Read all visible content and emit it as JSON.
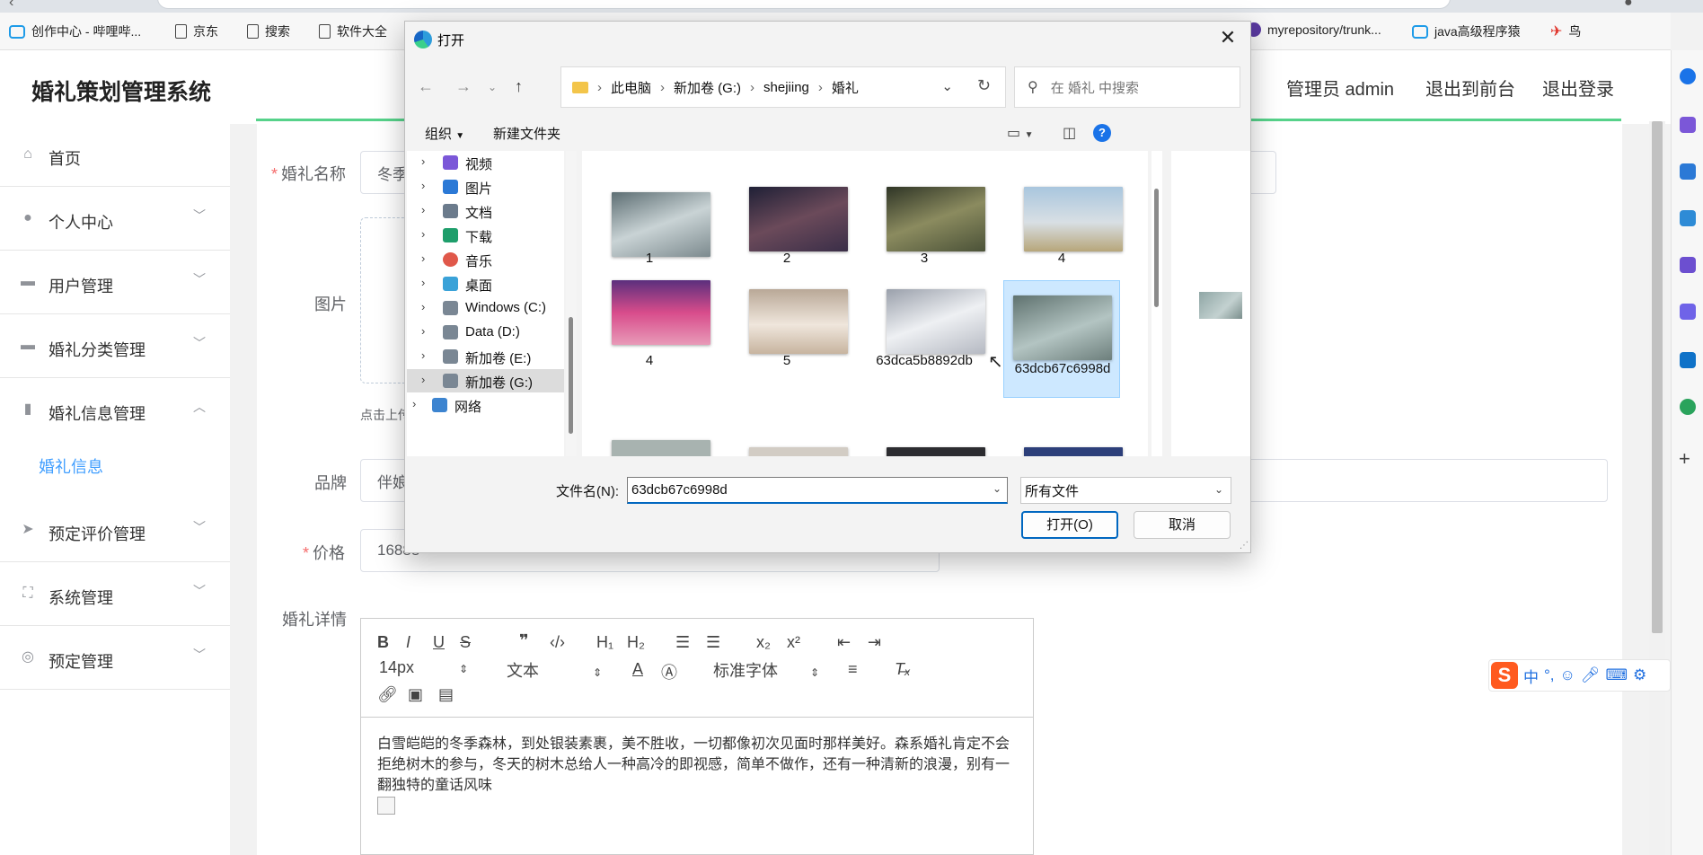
{
  "bookmarks": [
    "创作中心 - 哔哩哔...",
    "京东",
    "搜索",
    "软件大全",
    "myrepository/trunk...",
    "java高级程序猿",
    "鸟"
  ],
  "app": {
    "title": "婚礼策划管理系统",
    "admin_label": "管理员 admin",
    "to_front": "退出到前台",
    "logout": "退出登录"
  },
  "sidebar": {
    "items": [
      {
        "label": "首页",
        "icon": "home-icon"
      },
      {
        "label": "个人中心",
        "icon": "user-icon"
      },
      {
        "label": "用户管理",
        "icon": "chat-icon"
      },
      {
        "label": "婚礼分类管理",
        "icon": "folder-icon"
      },
      {
        "label": "婚礼信息管理",
        "icon": "chart-icon"
      },
      {
        "label": "预定评价管理",
        "icon": "send-icon"
      },
      {
        "label": "系统管理",
        "icon": "frame-icon"
      },
      {
        "label": "预定管理",
        "icon": "circle-icon"
      }
    ],
    "active_sub": "婚礼信息"
  },
  "form": {
    "name_label": "婚礼名称",
    "name_value": "冬季",
    "image_label": "图片",
    "upload_tip": "点击上传",
    "brand_label": "品牌",
    "brand_value": "伴娘",
    "price_label": "价格",
    "price_value": "16888",
    "detail_label": "婚礼详情"
  },
  "editor": {
    "font_size": "14px",
    "paragraph": "文本",
    "font_family": "标准字体",
    "content": "白雪皑皑的冬季森林，到处银装素裹，美不胜收，一切都像初次见面时那样美好。森系婚礼肯定不会拒绝树木的参与，冬天的树木总给人一种高冷的即视感，简单不做作，还有一种清新的浪漫，别有一翻独特的童话风味"
  },
  "dialog": {
    "title": "打开",
    "path": [
      "此电脑",
      "新加卷 (G:)",
      "shejiing",
      "婚礼"
    ],
    "search_placeholder": "在 婚礼 中搜索",
    "organize": "组织",
    "new_folder": "新建文件夹",
    "tree": [
      {
        "label": "视频",
        "color": "#7b57d8"
      },
      {
        "label": "图片",
        "color": "#2b79d6"
      },
      {
        "label": "文档",
        "color": "#6b7b8c"
      },
      {
        "label": "下载",
        "color": "#1e9e6b"
      },
      {
        "label": "音乐",
        "color": "#e0584a"
      },
      {
        "label": "桌面",
        "color": "#3aa2d8"
      },
      {
        "label": "Windows (C:)",
        "color": "#7a8794"
      },
      {
        "label": "Data (D:)",
        "color": "#7a8794"
      },
      {
        "label": "新加卷 (E:)",
        "color": "#7a8794"
      },
      {
        "label": "新加卷 (G:)",
        "color": "#7a8794"
      },
      {
        "label": "网络",
        "color": "#3c84d0"
      }
    ],
    "files": [
      {
        "name": "1",
        "tone": "#8a9ea5"
      },
      {
        "name": "2",
        "tone": "#3e2f4d"
      },
      {
        "name": "3",
        "tone": "#4f5a3c"
      },
      {
        "name": "4",
        "tone": "#a9c3d6"
      },
      {
        "name": "4",
        "tone": "#c8467a"
      },
      {
        "name": "5",
        "tone": "#d8cbbf"
      },
      {
        "name": "63dca5b8892db",
        "tone": "#c9cbd2"
      },
      {
        "name": "63dcb67c6998d",
        "tone": "#8fa6a5"
      }
    ],
    "filename_label": "文件名(N):",
    "filename_value": "63dcb67c6998d",
    "filetype_value": "所有文件",
    "open_label": "打开(O)",
    "cancel_label": "取消"
  },
  "ime": {
    "lang": "中",
    "punct": "°,"
  }
}
